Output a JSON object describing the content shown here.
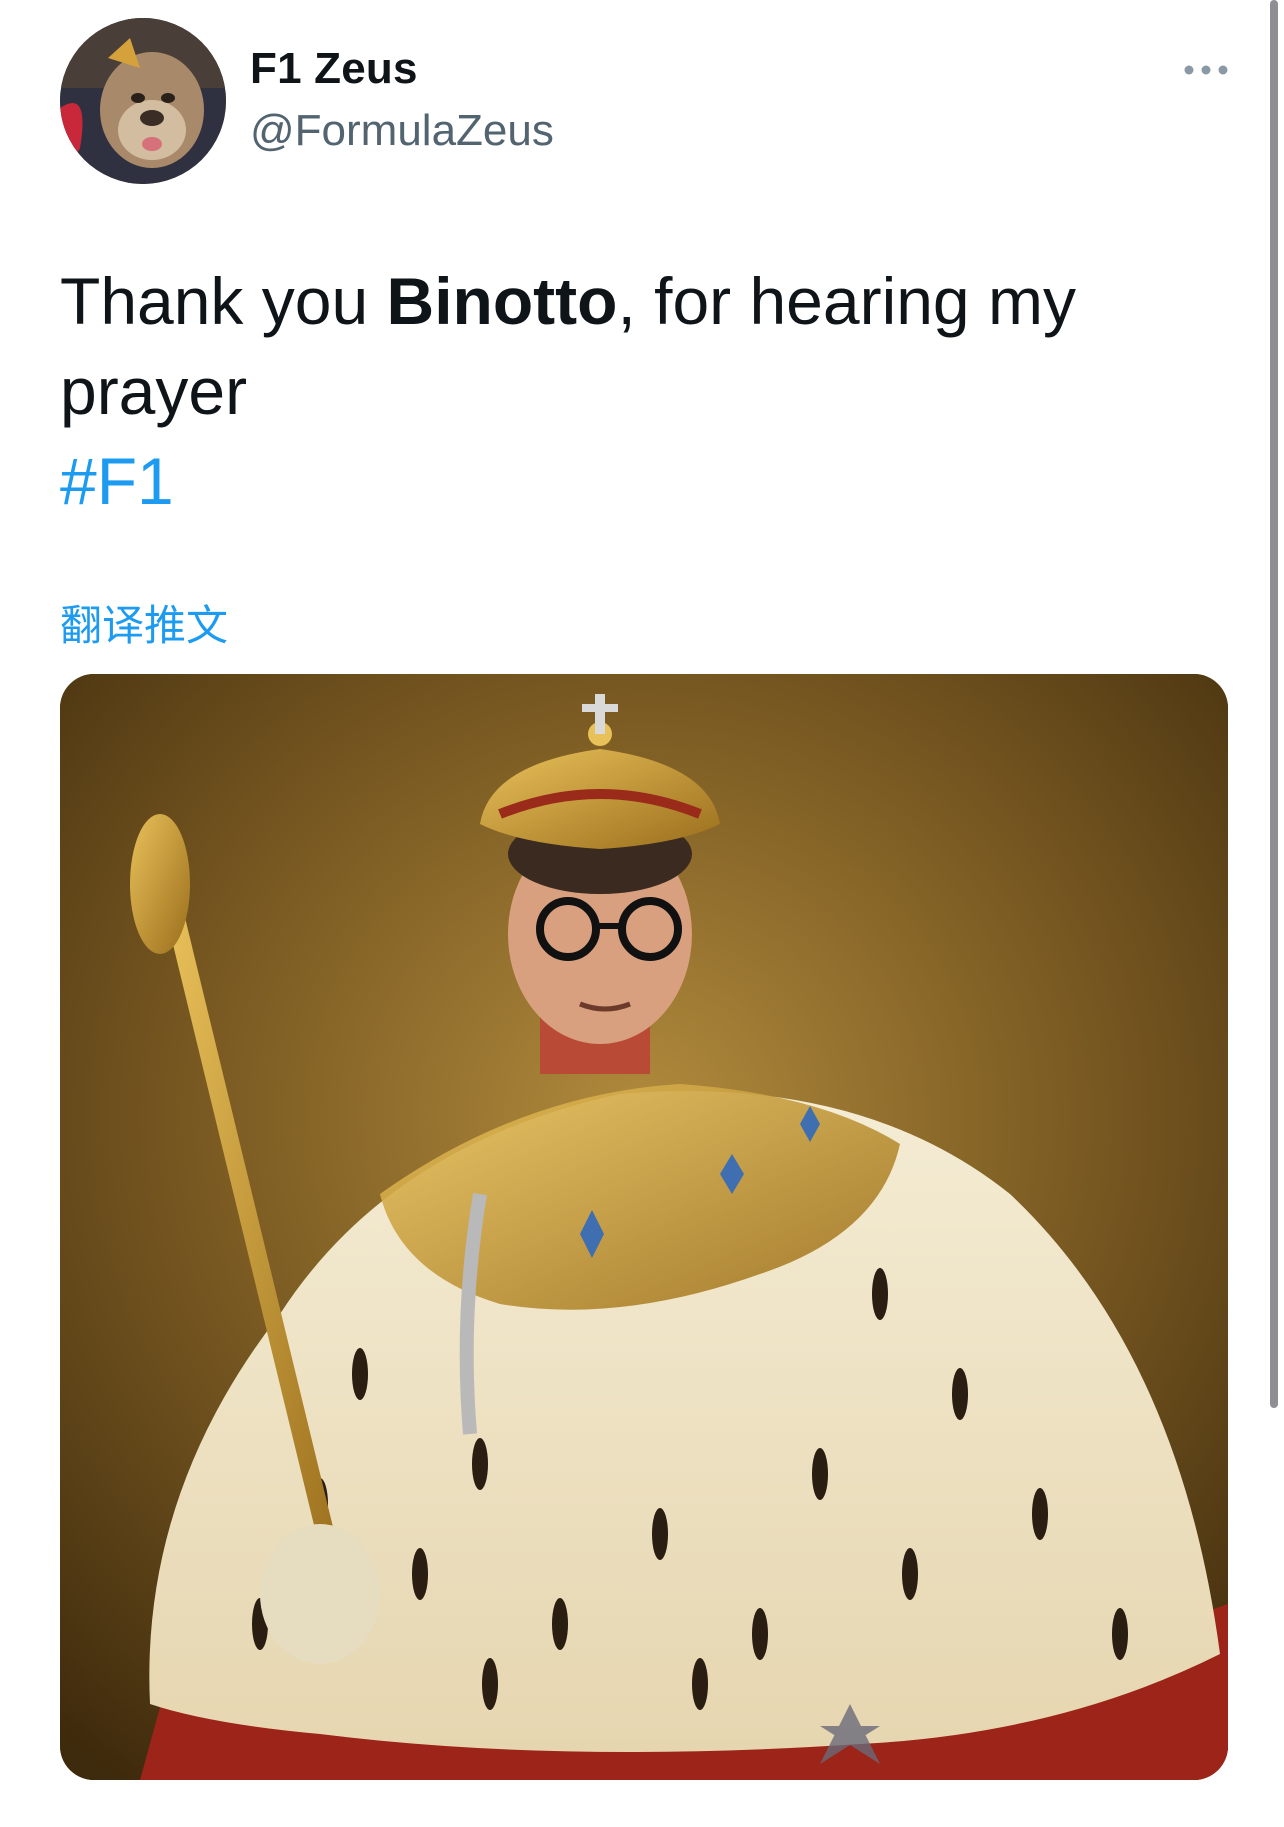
{
  "author": {
    "display_name": "F1 Zeus",
    "handle": "@FormulaZeus"
  },
  "tweet": {
    "text_before": "Thank you ",
    "text_bold": "Binotto",
    "text_after": ", for hearing my prayer",
    "hashtag": "#F1",
    "translate_label": "翻译推文"
  },
  "icons": {
    "more": "more-horizontal-icon"
  },
  "media": {
    "alt": ""
  },
  "colors": {
    "link": "#1d9bf0",
    "text": "#0f1419",
    "secondary_text": "#536471"
  }
}
